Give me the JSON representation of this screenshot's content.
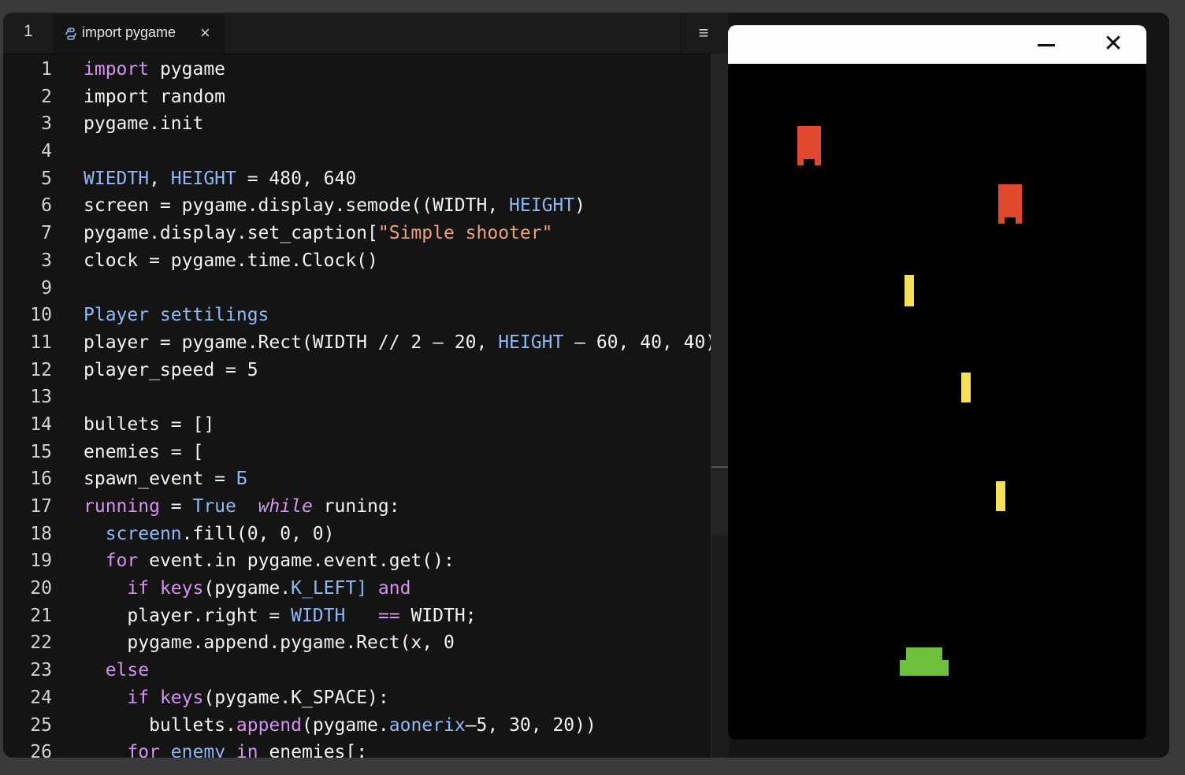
{
  "tabbar": {
    "number": "1",
    "tab_label": "import pygame",
    "tab_close": "×",
    "menu_icon": "≡"
  },
  "line_numbers": [
    "1",
    "2",
    "3",
    "4",
    "5",
    "6",
    "7",
    "3",
    "9",
    "10",
    "11",
    "12",
    "13",
    "14",
    "15",
    "16",
    "17",
    "18",
    "19",
    "20",
    "21",
    "22",
    "23",
    "24",
    "25",
    "26"
  ],
  "code_lines": [
    [
      {
        "t": "import",
        "c": "k"
      },
      {
        "t": " pygame"
      }
    ],
    [
      {
        "t": "import random"
      }
    ],
    [
      {
        "t": "pygame.init"
      }
    ],
    [],
    [
      {
        "t": "WIEDTH",
        "c": "b"
      },
      {
        "t": ", "
      },
      {
        "t": "HEIGHT",
        "c": "b"
      },
      {
        "t": " = 480, 640"
      }
    ],
    [
      {
        "t": "screen = pygame.display.semode((WIDTH, "
      },
      {
        "t": "HEIGHT",
        "c": "b"
      },
      {
        "t": ")"
      }
    ],
    [
      {
        "t": "pygame.display.set_caption["
      },
      {
        "t": "\"Simple shooter\"",
        "c": "s"
      }
    ],
    [
      {
        "t": "clock = pygame.time.Clock()"
      }
    ],
    [],
    [
      {
        "t": "Player settilings",
        "c": "b"
      }
    ],
    [
      {
        "t": "player = pygame.Rect(WIDTH // 2 – 20, "
      },
      {
        "t": "HEIGHT",
        "c": "b"
      },
      {
        "t": " – 60, 40, 40)"
      }
    ],
    [
      {
        "t": "player_speed = 5"
      }
    ],
    [],
    [
      {
        "t": "bullets = []"
      }
    ],
    [
      {
        "t": "enemies = ["
      }
    ],
    [
      {
        "t": "spawn_event = "
      },
      {
        "t": "Б",
        "c": "b"
      }
    ],
    [
      {
        "t": "running",
        "c": "k"
      },
      {
        "t": " = "
      },
      {
        "t": "True",
        "c": "b"
      },
      {
        "t": "  "
      },
      {
        "t": "while",
        "c": "i"
      },
      {
        "t": " runing:"
      }
    ],
    [
      {
        "t": "  "
      },
      {
        "t": "screenn",
        "c": "b"
      },
      {
        "t": ".fill(0, 0, 0)"
      }
    ],
    [
      {
        "t": "  "
      },
      {
        "t": "for",
        "c": "k"
      },
      {
        "t": " event.in pygame.event.get():"
      }
    ],
    [
      {
        "t": "    "
      },
      {
        "t": "if",
        "c": "k"
      },
      {
        "t": " "
      },
      {
        "t": "keys",
        "c": "k"
      },
      {
        "t": "(pygame."
      },
      {
        "t": "K_LEFT]",
        "c": "b"
      },
      {
        "t": " "
      },
      {
        "t": "and",
        "c": "k"
      }
    ],
    [
      {
        "t": "    player.right = "
      },
      {
        "t": "WIDTH",
        "c": "b"
      },
      {
        "t": "   "
      },
      {
        "t": "==",
        "c": "k"
      },
      {
        "t": " WIDTH;"
      }
    ],
    [
      {
        "t": "    pygame.append.pygame.Rect(x, 0"
      }
    ],
    [
      {
        "t": "  "
      },
      {
        "t": "else",
        "c": "k"
      }
    ],
    [
      {
        "t": "    "
      },
      {
        "t": "if",
        "c": "k"
      },
      {
        "t": " "
      },
      {
        "t": "keys",
        "c": "k"
      },
      {
        "t": "(pygame.K_SPACE):"
      }
    ],
    [
      {
        "t": "      bullets."
      },
      {
        "t": "append",
        "c": "k"
      },
      {
        "t": "(pygame."
      },
      {
        "t": "aonerix",
        "c": "b"
      },
      {
        "t": "–5, 30, 20))"
      }
    ],
    [
      {
        "t": "    "
      },
      {
        "t": "for",
        "c": "k"
      },
      {
        "t": " "
      },
      {
        "t": "enemy",
        "c": "b"
      },
      {
        "t": " "
      },
      {
        "t": "in",
        "c": "k"
      },
      {
        "t": " enemies[:"
      }
    ]
  ],
  "game_window": {
    "minimize_label": "minimize",
    "close_glyph": "✕",
    "colors": {
      "enemy": "#e0472c",
      "bullet": "#f6e05a",
      "player": "#6dbf3c",
      "background": "#000000"
    },
    "enemies": [
      "enemy",
      "enemy"
    ],
    "bullets": [
      "bullet",
      "bullet",
      "bullet"
    ],
    "player": "player"
  }
}
